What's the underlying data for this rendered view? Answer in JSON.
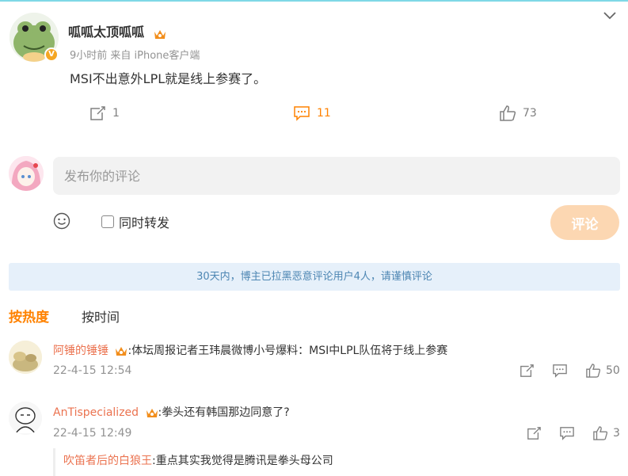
{
  "post": {
    "author": "呱呱太顶呱呱",
    "meta": "9小时前 来自 iPhone客户端",
    "text": "MSI不出意外LPL就是线上参赛了。",
    "repost_count": "1",
    "comment_count": "11",
    "like_count": "73",
    "icons": {
      "collapse": "chevron-down-icon",
      "repost": "repost-icon",
      "comment": "comment-icon",
      "like": "thumbs-up-icon",
      "badge": "verified-badge-icon",
      "crown": "vip-crown-icon"
    }
  },
  "composer": {
    "placeholder": "发布你的评论",
    "repost_label": "同时转发",
    "submit_label": "评论"
  },
  "notice": "30天内，博主已拉黑恶意评论用户4人，请谨慎评论",
  "sort_tabs": [
    "按热度",
    "按时间"
  ],
  "comments": [
    {
      "user": "阿锤的锤锤",
      "text": ":体坛周报记者王玮晨微博小号爆料：MSI中LPL队伍将于线上参赛",
      "date": "22-4-15 12:54",
      "like_count": "50"
    },
    {
      "user": "AnTispecialized",
      "text": ":拳头还有韩国那边同意了?",
      "date": "22-4-15 12:49",
      "like_count": "3",
      "reply": {
        "user": "吹笛者后的白狼王",
        "text": ":重点其实我觉得是腾讯是拳头母公司"
      }
    }
  ],
  "colors": {
    "accent": "#ff8200",
    "username": "#eb7350",
    "notice_bg": "#e6f0fa",
    "notice_text": "#4d86b3",
    "submit_bg": "#fcd7b2"
  }
}
